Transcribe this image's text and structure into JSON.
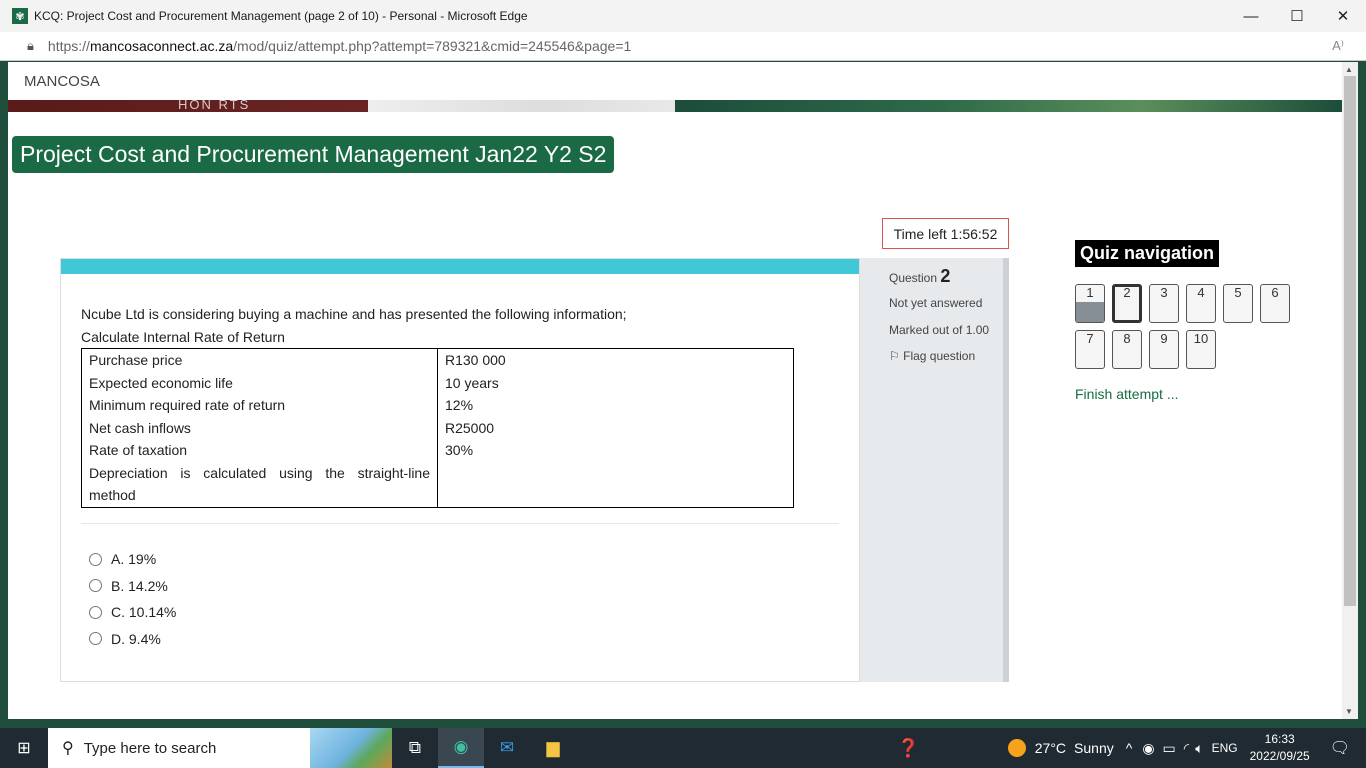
{
  "window": {
    "title": "KCQ: Project Cost and Procurement Management (page 2 of 10) - Personal - Microsoft Edge",
    "minimize": "—",
    "maximize": "☐",
    "close": "✕"
  },
  "address": {
    "scheme": "https://",
    "host": "mancosaconnect.ac.za",
    "path": "/mod/quiz/attempt.php?attempt=789321&cmid=245546&page=1",
    "read_aloud": "A⁾"
  },
  "site": {
    "brand": "MANCOSA",
    "banner_text": "HON   RTS",
    "course_title": "Project Cost and Procurement Management Jan22 Y2 S2"
  },
  "timer": {
    "label": "Time left 1:56:52"
  },
  "question": {
    "number_label": "Question",
    "number": "2",
    "status": "Not yet answered",
    "marks": "Marked out of 1.00",
    "flag": "Flag question",
    "flag_icon": "⚐",
    "intro": "Ncube Ltd is considering buying a machine and has presented the following information;",
    "prompt": "Calculate Internal Rate of Return",
    "table": [
      {
        "label": "Purchase price",
        "value": "R130 000"
      },
      {
        "label": "Expected economic life",
        "value": "10 years"
      },
      {
        "label": "Minimum required rate of return",
        "value": "12%"
      },
      {
        "label": "Net cash inflows",
        "value": "R25000"
      },
      {
        "label": "Rate of taxation",
        "value": "30%"
      },
      {
        "label": "Depreciation is calculated using the straight-line method",
        "value": ""
      }
    ],
    "answers": [
      "A. 19%",
      "B. 14.2%",
      "C. 10.14%",
      "D. 9.4%"
    ]
  },
  "quiz_nav": {
    "title": "Quiz navigation",
    "buttons": [
      "1",
      "2",
      "3",
      "4",
      "5",
      "6",
      "7",
      "8",
      "9",
      "10"
    ],
    "answered": [
      "1"
    ],
    "current": "2",
    "finish": "Finish attempt ..."
  },
  "taskbar": {
    "search_placeholder": "Type here to search",
    "weather_temp": "27°C",
    "weather_cond": "Sunny",
    "lang": "ENG",
    "time": "16:33",
    "date": "2022/09/25"
  }
}
